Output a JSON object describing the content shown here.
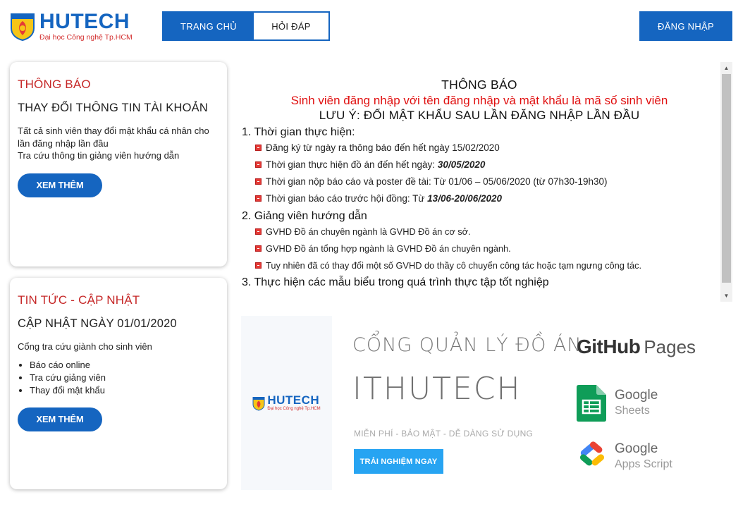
{
  "brand": {
    "name": "HUTECH",
    "subtitle": "Đại học Công nghệ Tp.HCM",
    "colors": {
      "primary": "#1565c0",
      "accent_red": "#c62828"
    }
  },
  "nav": {
    "items": [
      {
        "label": "TRANG CHỦ",
        "active": true
      },
      {
        "label": "HỎI ĐÁP",
        "active": false
      }
    ],
    "login_label": "ĐĂNG NHẬP"
  },
  "cards": [
    {
      "heading": "THÔNG BÁO",
      "title": "THAY ĐỔI THÔNG TIN TÀI KHOẢN",
      "lines": [
        "Tất cả sinh viên thay đổi mật khẩu cá nhân cho lần đăng nhập lần đầu",
        "Tra cứu thông tin giảng viên hướng dẫn"
      ],
      "button": "XEM THÊM"
    },
    {
      "heading": "TIN TỨC - CẬP NHẬT",
      "title": "CẬP NHẬT NGÀY 01/01/2020",
      "lines": [
        "Cổng tra cứu giành cho sinh viên"
      ],
      "list": [
        "Báo cáo online",
        "Tra cứu giảng viên",
        "Thay đổi mật khẩu"
      ],
      "button": "XEM THÊM"
    }
  ],
  "notice": {
    "title": "THÔNG BÁO",
    "red_line": "Sinh viên đăng nhập với tên đăng nhập và mật khẩu là mã số sinh viên",
    "note": "LƯU Ý: ĐỔI MẬT KHẨU SAU LẦN ĐĂNG NHẬP LẦN ĐẦU",
    "sections": [
      {
        "title": "1. Thời gian thực hiện:",
        "items": [
          {
            "text": "Đăng ký từ ngày ra thông báo đến hết ngày 15/02/2020",
            "em": ""
          },
          {
            "text": "Thời gian thực hiện đồ án đến hết ngày: ",
            "em": "30/05/2020"
          },
          {
            "text": "Thời gian nộp báo cáo và poster đề tài: Từ 01/06 – 05/06/2020 (từ 07h30-19h30)",
            "em": ""
          },
          {
            "text": "Thời gian báo cáo trước hội đồng: Từ ",
            "em": "13/06-20/06/2020"
          }
        ]
      },
      {
        "title": "2. Giảng viên hướng dẫn",
        "items": [
          {
            "text": "GVHD Đồ án chuyên ngành là GVHD Đồ án cơ sở.",
            "em": ""
          },
          {
            "text": "GVHD Đồ án tổng hợp ngành là GVHD Đồ án chuyên ngành.",
            "em": ""
          },
          {
            "text": "Tuy nhiên đã có thay đổi một số GVHD do thầy cô chuyển công tác hoặc tạm ngưng công tác.",
            "em": ""
          }
        ]
      },
      {
        "title": "3. Thực hiện các mẫu biểu trong quá trình thực tập tốt nghiệp",
        "items": []
      }
    ]
  },
  "banner": {
    "title": "CỔNG QUẢN LÝ ĐỒ ÁN",
    "brand": "ITHUTECH",
    "tagline": "MIỄN PHÍ - BẢO MẬT - DỄ DÀNG SỬ DỤNG",
    "button": "TRẢI NGHIỆM NGAY",
    "logo_name": "HUTECH",
    "logo_sub": "Đại học Công nghệ Tp.HCM",
    "github": {
      "a": "GitHub",
      "b": "Pages"
    },
    "google_sheets": {
      "g": "Google",
      "p": "Sheets"
    },
    "google_script": {
      "g": "Google",
      "p": "Apps Script"
    }
  }
}
